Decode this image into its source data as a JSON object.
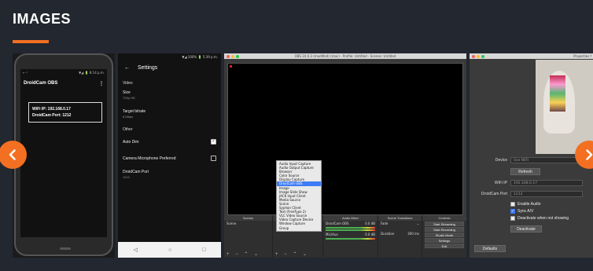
{
  "section": {
    "title": "IMAGES"
  },
  "colors": {
    "accent": "#f36f21",
    "background": "#23272f"
  },
  "thumb1": {
    "status_left": "← ᵖ",
    "status_right": "▼◢ 🔋 8:14 p.m.",
    "app_title": "DroidCam OBS",
    "menu_glyph": "⋮",
    "wifi_ip": "WiFi IP: 192.168.0.17",
    "port": "DroidCam Port: 1212"
  },
  "thumb2": {
    "status": "▼◢ 100% 🔋 5:39 p.m.",
    "back_glyph": "←",
    "header": "Settings",
    "sec_video": "Video",
    "size_label": "Size",
    "size_value": "720p HD",
    "bitrate_label": "Target bitrate",
    "bitrate_value": "8 Mbps",
    "sec_other": "Other",
    "autodim_label": "Auto Dim",
    "autodim_checked": true,
    "mic_label": "Camera Microphone Preferred",
    "mic_checked": false,
    "port_label": "DroidCam Port",
    "port_value": "1212",
    "nav": [
      "◁",
      "○",
      "□"
    ]
  },
  "thumb3": {
    "window_title": "OBS 24.0.3 (modified) (mac) - Profile: Untitled - Scenes: Untitled",
    "menu_items": [
      {
        "label": "Audio Input Capture",
        "active": false
      },
      {
        "label": "Audio Output Capture",
        "active": false
      },
      {
        "label": "Browser",
        "active": false
      },
      {
        "label": "Color Source",
        "active": false
      },
      {
        "label": "Display Capture",
        "active": false
      },
      {
        "label": "DroidCam OBS",
        "active": true
      },
      {
        "label": "Image",
        "active": false
      },
      {
        "label": "Image Slide Show",
        "active": false
      },
      {
        "label": "JACK Input Client",
        "active": false
      },
      {
        "label": "Media Source",
        "active": false
      },
      {
        "label": "Scene",
        "active": false
      },
      {
        "label": "Syphon Client",
        "active": false
      },
      {
        "label": "Text (FreeType 2)",
        "active": false
      },
      {
        "label": "VLC Video Source",
        "active": false
      },
      {
        "label": "Video Capture Device",
        "active": false
      },
      {
        "label": "Window Capture",
        "active": false
      },
      {
        "label": "Group",
        "active": false
      }
    ],
    "panels": {
      "scenes": "Scenes",
      "scene_item": "Scene",
      "mixer": "Audio Mixer",
      "mixer_track1": "DroidCam OBS",
      "mixer_track1_db": "0.0 dB",
      "mixer_track2": "Mic/Aux",
      "mixer_track2_db": "0.0 dB",
      "transitions": "Scene Transitions",
      "fade": "Fade",
      "duration_label": "Duration",
      "duration_value": "300 ms",
      "controls": "Controls",
      "start_streaming": "Start Streaming",
      "start_recording": "Start Recording",
      "studio_mode": "Studio Mode",
      "settings": "Settings",
      "exit": "Exit",
      "foot": "+ − ⌃ ⌄"
    }
  },
  "thumb4": {
    "window_title": "Properties f",
    "device_label": "Device",
    "device_value": "Use WiFi",
    "refresh": "Refresh",
    "wifi_ip_label": "WiFi IP",
    "wifi_ip_value": "192.168.0.17",
    "port_label": "DroidCam Port",
    "port_value": "1212",
    "enable_audio": "Enable Audio",
    "sync_av": "Sync A/V",
    "deactivate_hidden": "Deactivate when not showing",
    "deactivate": "Deactivate",
    "defaults": "Defaults"
  },
  "nav": {
    "prev_icon": "chevron-left-icon",
    "next_icon": "chevron-right-icon"
  }
}
